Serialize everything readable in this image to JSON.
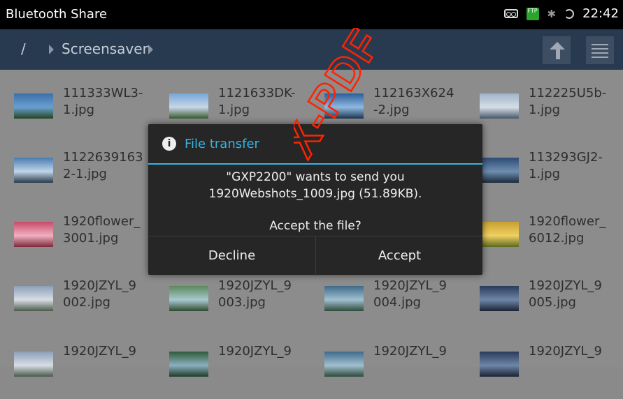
{
  "statusbar": {
    "title": "Bluetooth Share",
    "time": "22:42",
    "ftp_badge": "FTP"
  },
  "navbar": {
    "root": "/",
    "crumb": "Screensaver"
  },
  "files": [
    {
      "name": "111333WL3-\n1.jpg"
    },
    {
      "name": "1121633DK-\n1.jpg"
    },
    {
      "name": "112163X624\n-2.jpg"
    },
    {
      "name": "112225U5b-\n1.jpg"
    },
    {
      "name": "1122639163\n2-1.jpg"
    },
    {
      "name": ""
    },
    {
      "name": ""
    },
    {
      "name": "113293GJ2-\n1.jpg"
    },
    {
      "name": "1920flower_\n3001.jpg"
    },
    {
      "name": ""
    },
    {
      "name": ""
    },
    {
      "name": "1920flower_\n6012.jpg"
    },
    {
      "name": "1920JZYL_9\n002.jpg"
    },
    {
      "name": "1920JZYL_9\n003.jpg"
    },
    {
      "name": "1920JZYL_9\n004.jpg"
    },
    {
      "name": "1920JZYL_9\n005.jpg"
    },
    {
      "name": "1920JZYL_9"
    },
    {
      "name": "1920JZYL_9"
    },
    {
      "name": "1920JZYL_9"
    },
    {
      "name": "1920JZYL_9"
    }
  ],
  "dialog": {
    "title": "File transfer",
    "message_line1": "\"GXP2200\" wants to send you",
    "message_line2": "1920Webshots_1009.jpg (51.89KB).",
    "question": "Accept the file?",
    "decline": "Decline",
    "accept": "Accept"
  },
  "watermark": {
    "text": "X-PDF",
    "color": "#ff2200"
  },
  "colors": {
    "accent": "#33b5e5",
    "navbar": "#273a4f",
    "dialog_bg": "#262626"
  }
}
